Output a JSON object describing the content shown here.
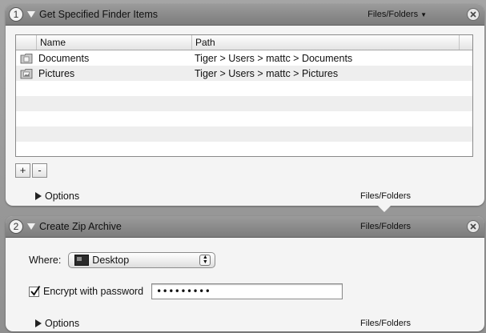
{
  "actions": [
    {
      "step": "1",
      "title": "Get Specified Finder Items",
      "type_label": "Files/Folders",
      "type_arrow": "▼",
      "table": {
        "columns": [
          "Name",
          "Path"
        ],
        "rows": [
          {
            "name": "Documents",
            "path": "Tiger > Users > mattc > Documents"
          },
          {
            "name": "Pictures",
            "path": "Tiger > Users > mattc > Pictures"
          }
        ]
      },
      "add_label": "+",
      "remove_label": "-",
      "options_label": "Options",
      "footer_type": "Files/Folders"
    },
    {
      "step": "2",
      "title": "Create Zip Archive",
      "type_label": "Files/Folders",
      "where_label": "Where:",
      "where_value": "Desktop",
      "encrypt_label": "Encrypt with password",
      "encrypt_checked": true,
      "password_masked": "•••••••••",
      "options_label": "Options",
      "footer_type": "Files/Folders"
    }
  ]
}
